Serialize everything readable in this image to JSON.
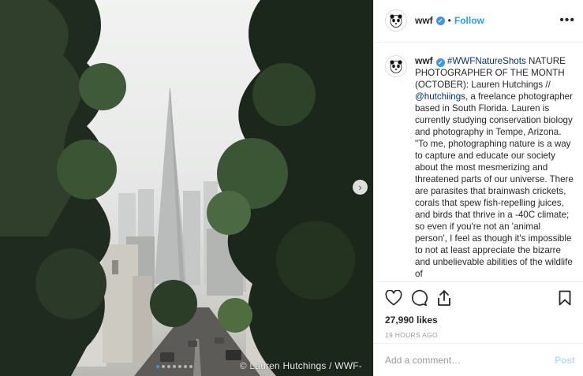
{
  "photo": {
    "credit": "© Lauren Hutchings / WWF-",
    "carousel_index": 1,
    "carousel_total": 7
  },
  "account": {
    "username": "wwf",
    "verified_icon": "verified-badge-icon",
    "separator": "•",
    "follow_label": "Follow",
    "more_label": "•••"
  },
  "caption": {
    "username": "wwf",
    "hashtag": "#WWFNatureShots",
    "text_before_mention": "NATURE PHOTOGRAPHER OF THE MONTH (OCTOBER): Lauren Hutchings // ",
    "mention": "@hutchiings",
    "text_after_mention": ", a freelance photographer based in South Florida. Lauren is currently studying conservation biology and photography in Tempe, Arizona. \"To me, photographing nature is a way to capture and educate our society about the most mesmerizing and threatened parts of our universe. There are parasites that brainwash crickets, corals that spew fish-repelling juices, and birds that thrive in a -40C climate; so even if you're not an 'animal person', I feel as though it's impossible to not at least appreciate the bizarre and unbelievable abilities of the wildlife of"
  },
  "engagement": {
    "likes": "27,990 likes",
    "timestamp": "19 HOURS AGO"
  },
  "comment": {
    "placeholder": "Add a comment…",
    "post_label": "Post"
  },
  "colors": {
    "accent": "#3897f0",
    "link": "#003569",
    "post_disabled": "#b2dffc"
  }
}
